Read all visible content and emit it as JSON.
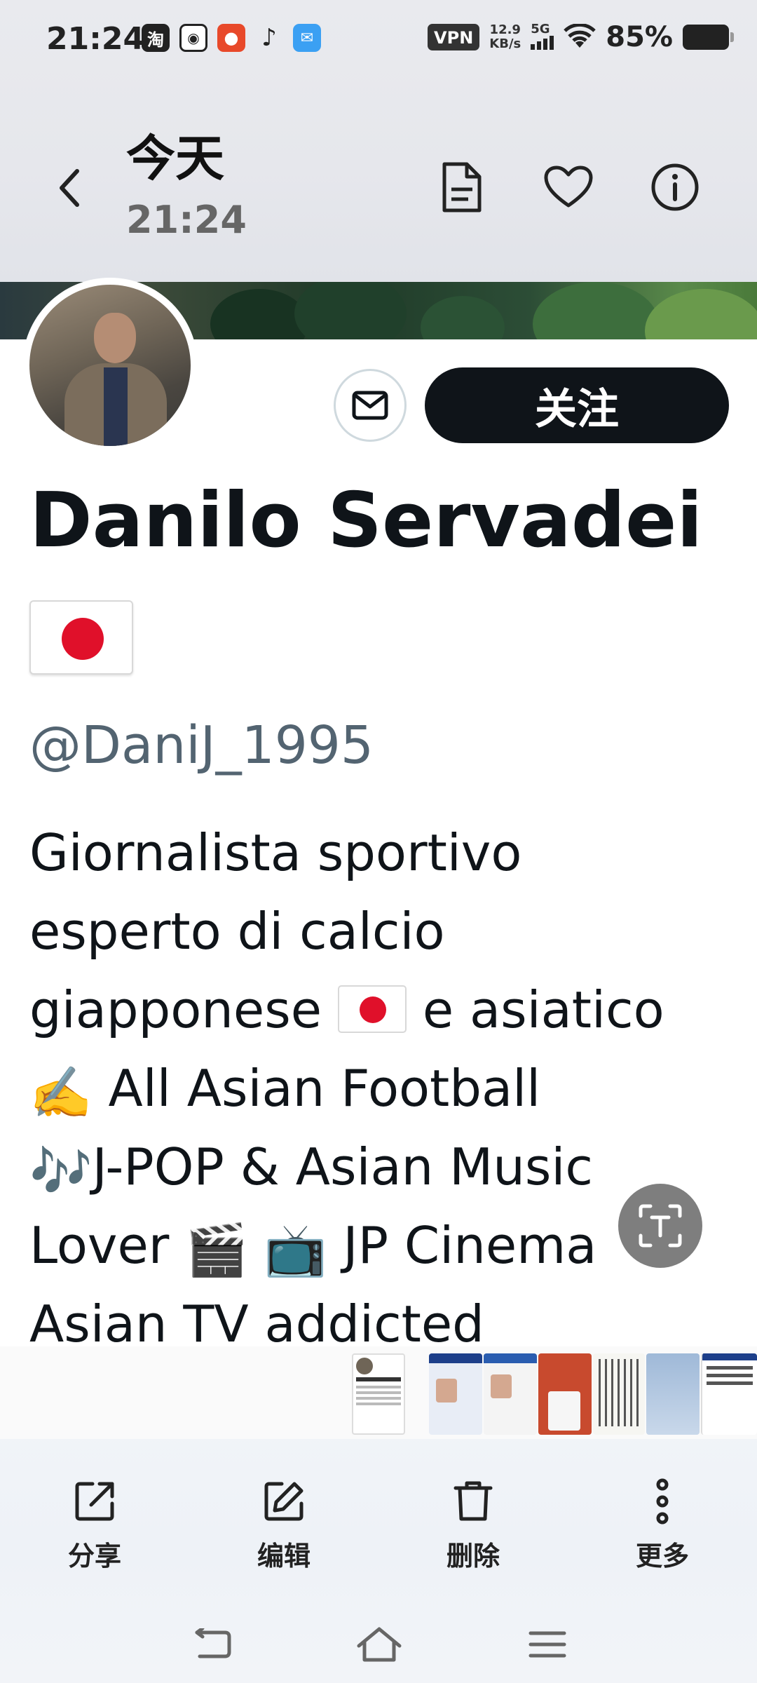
{
  "status_bar": {
    "time": "21:24",
    "app_icons": [
      "taobao-icon",
      "weibo-icon",
      "app-icon",
      "tiktok-icon",
      "mail-app-icon"
    ],
    "vpn": "VPN",
    "speed_value": "12.9",
    "speed_unit": "KB/s",
    "network": "5G",
    "battery": "85%"
  },
  "viewer": {
    "title": "今天",
    "time": "21:24",
    "icons": [
      "document-icon",
      "heart-icon",
      "info-icon"
    ]
  },
  "profile": {
    "follow_label": "关注",
    "name": "Danilo Servadei",
    "handle": "@DaniJ_1995",
    "bio_lines": [
      "Giornalista sportivo",
      "esperto di calcio",
      "giapponese",
      "e asiatico",
      "All Asian Football",
      "J-POP & Asian Music",
      "Lover",
      "JP Cinema",
      "Asian TV addicted"
    ]
  },
  "actions": [
    {
      "label": "分享",
      "icon": "share-icon"
    },
    {
      "label": "编辑",
      "icon": "edit-icon"
    },
    {
      "label": "删除",
      "icon": "trash-icon"
    },
    {
      "label": "更多",
      "icon": "more-icon"
    }
  ],
  "colors": {
    "follow_bg": "#0f1419",
    "handle": "#536471",
    "flag_red": "#e0102a"
  }
}
